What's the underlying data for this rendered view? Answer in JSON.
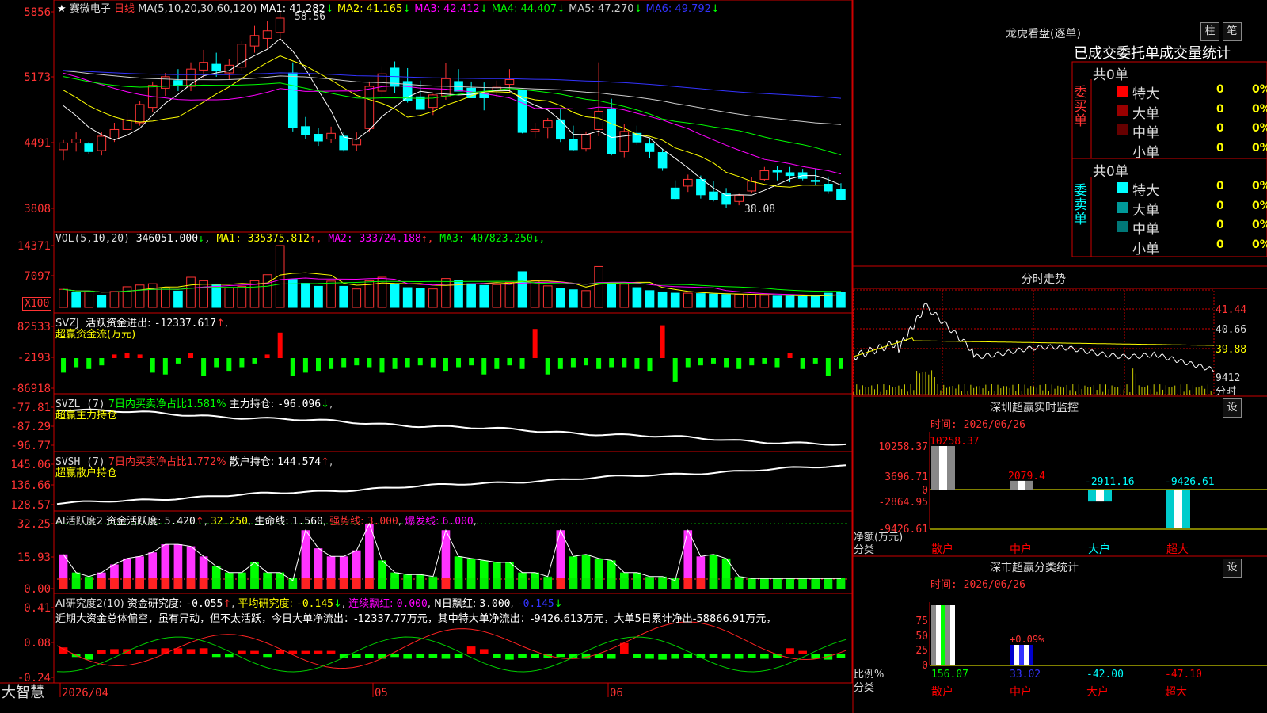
{
  "app_logo": "大智慧",
  "main_panel": {
    "stock_name": "赛微电子",
    "period": "日线",
    "ma_label": "MA(5,10,20,30,60,120)",
    "ma": [
      {
        "name": "MA1",
        "value": "41.282",
        "color": "#ffffff"
      },
      {
        "name": "MA2",
        "value": "41.165",
        "color": "#ffff00"
      },
      {
        "name": "MA3",
        "value": "42.412",
        "color": "#ff00ff"
      },
      {
        "name": "MA4",
        "value": "44.407",
        "color": "#00ff00"
      },
      {
        "name": "MA5",
        "value": "47.270",
        "color": "#cccccc"
      },
      {
        "name": "MA6",
        "value": "49.792",
        "color": "#3333ff"
      }
    ],
    "y_ticks": [
      "5856",
      "5173",
      "4491",
      "3808"
    ],
    "high_label": "58.56",
    "low_label": "38.08"
  },
  "vol_panel": {
    "label": "VOL(5,10,20)",
    "value": "346051.000",
    "ma": [
      {
        "name": "MA1",
        "value": "335375.812",
        "color": "#ffff00"
      },
      {
        "name": "MA2",
        "value": "333724.188",
        "color": "#ff00ff"
      },
      {
        "name": "MA3",
        "value": "407823.250",
        "color": "#00ff00"
      }
    ],
    "y_ticks": [
      "14371",
      "7097"
    ],
    "unit": "X100"
  },
  "svzj_panel": {
    "label": "SVZJ",
    "field": "活跃资金进出:",
    "value": "-12337.617",
    "subtitle": "超赢资金流(万元)",
    "y_ticks": [
      "82533",
      "-2193",
      "-86918"
    ]
  },
  "svzl_panel": {
    "label": "SVZL (7)",
    "ratio": "7日内买卖净占比1.581%",
    "field": "主力持仓:",
    "value": "-96.096",
    "subtitle": "超赢主力持仓",
    "y_ticks": [
      "-77.81",
      "-87.29",
      "-96.77"
    ]
  },
  "svsh_panel": {
    "label": "SVSH (7)",
    "ratio": "7日内买卖净占比1.772%",
    "field": "散户持仓:",
    "value": "144.574",
    "subtitle": "超赢散户持仓",
    "y_ticks": [
      "145.06",
      "136.66",
      "128.57"
    ]
  },
  "ai_active_panel": {
    "label": "AI活跃度2",
    "field": "资金活跃度:",
    "value": "5.420",
    "v2": "32.250",
    "life_label": "生命线:",
    "life": "1.560",
    "strong_label": "强势线:",
    "strong": "3.000",
    "burst_label": "爆发线:",
    "burst": "6.000",
    "y_ticks": [
      "32.25",
      "15.93",
      "0.00"
    ]
  },
  "ai_research_panel": {
    "label": "AI研究度2(10)",
    "field": "资金研究度:",
    "value": "-0.055",
    "avg_label": "平均研究度:",
    "avg": "-0.145",
    "red_label": "连续飘红:",
    "red": "0.000",
    "nred_label": "N日飘红:",
    "nred": "3.000",
    "last": "-0.145",
    "comment": "近期大资金总体偏空，虽有异动，但不太活跃，今日大单净流出：-12337.77万元，其中特大单净流出：-9426.613万元，大单5日累计净出-58866.91万元，",
    "y_ticks": [
      "0.41",
      "0.08",
      "-0.24"
    ]
  },
  "x_axis": {
    "labels": [
      "2026/04",
      "05",
      "06"
    ]
  },
  "dragon_tiger": {
    "title": "龙虎看盘(逐单)",
    "btn_bar": "柱",
    "btn_pen": "笔",
    "header": "已成交委托单成交量统计",
    "buy": {
      "side_label": "委买单",
      "total": "共0单",
      "rows": [
        {
          "name": "特大",
          "value": "0",
          "pct": "0%",
          "color": "#ff0000"
        },
        {
          "name": "大单",
          "value": "0",
          "pct": "0%",
          "color": "#990000"
        },
        {
          "name": "中单",
          "value": "0",
          "pct": "0%",
          "color": "#660000"
        },
        {
          "name": "小单",
          "value": "0",
          "pct": "0%",
          "color": "#000000"
        }
      ]
    },
    "sell": {
      "side_label": "委卖单",
      "total": "共0单",
      "rows": [
        {
          "name": "特大",
          "value": "0",
          "pct": "0%",
          "color": "#00ffff"
        },
        {
          "name": "大单",
          "value": "0",
          "pct": "0%",
          "color": "#009999"
        },
        {
          "name": "中单",
          "value": "0",
          "pct": "0%",
          "color": "#007777"
        },
        {
          "name": "小单",
          "value": "0",
          "pct": "0%",
          "color": "#000000"
        }
      ]
    }
  },
  "intraday": {
    "title": "分时走势",
    "y_ticks": [
      "41.44",
      "40.66",
      "39.88"
    ],
    "vol_tick": "9412",
    "unit": "分时"
  },
  "realtime_monitor": {
    "title": "深圳超赢实时监控",
    "btn": "设",
    "time_label": "时间: 2026/06/26",
    "y_ticks": [
      "10258.37",
      "3696.71",
      "0",
      "-2864.95",
      "-9426.61"
    ],
    "y_label": "净额(万元)",
    "x_label": "分类",
    "categories": [
      "散户",
      "中户",
      "大户",
      "超大"
    ],
    "values": [
      "10258.37",
      "2079.4",
      "-2911.16",
      "-9426.61"
    ],
    "category_colors": [
      "#ff0000",
      "#ff0000",
      "#00ffff",
      "#ff0000"
    ],
    "value_colors": [
      "#ff0000",
      "#ff0000",
      "#00ffff",
      "#00ffff"
    ]
  },
  "category_stats": {
    "title": "深市超赢分类统计",
    "btn": "设",
    "time_label": "时间: 2026/06/26",
    "y_ticks": [
      "75",
      "50",
      "25",
      "0"
    ],
    "y_label": "比例%",
    "x_label": "分类",
    "bar_label": "+0.09%",
    "categories": [
      "散户",
      "中户",
      "大户",
      "超大"
    ],
    "values": [
      "156.07",
      "33.02",
      "-42.00",
      "-47.10"
    ],
    "value_colors": [
      "#00ff00",
      "#3333ff",
      "#00ffff",
      "#ff0000"
    ]
  },
  "chart_data": [
    {
      "type": "candlestick",
      "title": "赛微电子 日线",
      "ylim": [
        38.08,
        58.56
      ],
      "ohlc": [
        [
          44.2,
          45.2,
          43.1,
          44.9
        ],
        [
          44.9,
          46.0,
          44.0,
          45.3
        ],
        [
          44.8,
          45.0,
          43.7,
          44.0
        ],
        [
          44.1,
          46.0,
          43.6,
          45.6
        ],
        [
          45.3,
          47.0,
          45.0,
          46.3
        ],
        [
          46.3,
          48.2,
          45.6,
          47.3
        ],
        [
          47.0,
          49.3,
          46.7,
          48.9
        ],
        [
          48.6,
          51.3,
          48.1,
          50.9
        ],
        [
          50.6,
          52.2,
          49.8,
          51.8
        ],
        [
          51.4,
          52.6,
          50.3,
          50.9
        ],
        [
          50.8,
          53.3,
          50.3,
          52.6
        ],
        [
          52.5,
          54.6,
          51.6,
          53.3
        ],
        [
          53.1,
          54.3,
          51.8,
          52.4
        ],
        [
          52.2,
          53.6,
          51.5,
          53.0
        ],
        [
          52.8,
          55.5,
          52.4,
          55.2
        ],
        [
          55.0,
          57.1,
          54.3,
          56.1
        ],
        [
          55.8,
          57.6,
          54.7,
          56.6
        ],
        [
          56.4,
          58.56,
          55.6,
          57.9
        ],
        [
          52.2,
          53.3,
          46.1,
          46.5
        ],
        [
          46.6,
          47.6,
          45.3,
          45.8
        ],
        [
          45.8,
          46.5,
          44.6,
          45.1
        ],
        [
          45.3,
          46.6,
          44.9,
          45.9
        ],
        [
          45.6,
          46.0,
          44.0,
          44.2
        ],
        [
          44.7,
          46.0,
          44.1,
          45.3
        ],
        [
          46.4,
          51.3,
          46.0,
          50.8
        ],
        [
          50.3,
          52.9,
          49.5,
          52.1
        ],
        [
          52.7,
          53.4,
          50.1,
          50.8
        ],
        [
          51.3,
          52.7,
          49.1,
          49.3
        ],
        [
          49.7,
          51.4,
          48.8,
          48.4
        ],
        [
          48.6,
          50.0,
          47.8,
          49.9
        ],
        [
          49.8,
          53.2,
          49.4,
          51.6
        ],
        [
          51.3,
          52.6,
          50.7,
          50.3
        ],
        [
          50.6,
          51.3,
          49.6,
          49.6
        ],
        [
          50.1,
          51.2,
          48.3,
          49.6
        ],
        [
          50.4,
          51.4,
          49.6,
          50.7
        ],
        [
          51.0,
          52.6,
          50.2,
          51.5
        ],
        [
          50.4,
          48.6,
          45.9,
          46.0
        ],
        [
          46.1,
          47.0,
          45.4,
          46.3
        ],
        [
          46.5,
          47.5,
          45.4,
          47.2
        ],
        [
          47.3,
          48.4,
          45.0,
          45.3
        ],
        [
          45.3,
          46.7,
          44.1,
          44.2
        ],
        [
          44.3,
          46.1,
          44.0,
          45.8
        ],
        [
          46.3,
          53.3,
          45.6,
          48.2
        ],
        [
          48.4,
          49.5,
          43.6,
          43.8
        ],
        [
          44.0,
          46.9,
          43.4,
          46.1
        ],
        [
          45.9,
          46.7,
          44.7,
          45.0
        ],
        [
          44.8,
          45.3,
          43.3,
          44.0
        ],
        [
          43.9,
          44.3,
          42.0,
          42.3
        ],
        [
          40.2,
          41.0,
          39.0,
          39.1
        ],
        [
          40.4,
          41.6,
          39.8,
          41.1
        ],
        [
          41.1,
          41.5,
          39.1,
          39.5
        ],
        [
          39.8,
          40.9,
          38.8,
          39.0
        ],
        [
          39.6,
          40.2,
          38.08,
          38.5
        ],
        [
          38.8,
          39.6,
          38.4,
          39.4
        ],
        [
          39.9,
          41.3,
          39.7,
          40.9
        ],
        [
          41.1,
          42.4,
          40.9,
          42.0
        ],
        [
          42.0,
          42.5,
          41.0,
          41.9
        ],
        [
          41.8,
          42.4,
          40.8,
          41.5
        ],
        [
          41.8,
          42.2,
          41.0,
          41.2
        ],
        [
          41.0,
          42.2,
          40.5,
          40.9
        ],
        [
          40.6,
          41.4,
          39.6,
          39.9
        ],
        [
          40.1,
          40.7,
          38.9,
          39.0
        ]
      ]
    },
    {
      "type": "bar",
      "title": "VOL(5,10,20)",
      "ylim": [
        0,
        14371
      ],
      "values": [
        4200,
        3500,
        3800,
        2800,
        3700,
        4800,
        5200,
        5500,
        4600,
        3800,
        7000,
        6200,
        5200,
        4600,
        4900,
        6200,
        7600,
        14371,
        6500,
        5600,
        4900,
        6100,
        4900,
        4300,
        6200,
        7000,
        5400,
        4600,
        4500,
        4300,
        6700,
        6200,
        5500,
        5100,
        5300,
        5800,
        8300,
        6200,
        5000,
        4500,
        4100,
        3900,
        9500,
        5700,
        5400,
        4600,
        3900,
        3600,
        3300,
        3300,
        3200,
        3100,
        3000,
        3000,
        2900,
        2800,
        2600,
        2600,
        2500,
        2700,
        3300,
        3460
      ],
      "up": [
        1,
        0,
        1,
        0,
        1,
        1,
        1,
        1,
        1,
        0,
        1,
        1,
        0,
        1,
        1,
        1,
        1,
        1,
        0,
        0,
        0,
        1,
        0,
        1,
        1,
        1,
        0,
        0,
        0,
        1,
        1,
        0,
        0,
        0,
        1,
        1,
        0,
        1,
        1,
        0,
        0,
        1,
        1,
        0,
        1,
        0,
        0,
        0,
        0,
        1,
        0,
        0,
        0,
        1,
        1,
        1,
        0,
        0,
        0,
        0,
        0,
        0
      ]
    },
    {
      "type": "bar",
      "title": "SVZJ",
      "ylim": [
        -86918,
        82533
      ],
      "values": [
        -8,
        -5,
        -6,
        -4,
        2,
        3,
        2,
        -8,
        -9,
        -3,
        3,
        -10,
        -5,
        -7,
        -5,
        -3,
        2,
        14,
        -10,
        -8,
        -7,
        -6,
        -5,
        -4,
        -5,
        -8,
        -6,
        -5,
        -4,
        -5,
        -7,
        -5,
        -4,
        -9,
        -6,
        -4,
        -6,
        16,
        -9,
        -6,
        -5,
        -4,
        -6,
        -5,
        -5,
        -6,
        -7,
        18,
        -13,
        -5,
        -4,
        -3,
        -5,
        -6,
        -4,
        -3,
        -5,
        3,
        -6,
        -3,
        -10,
        -6
      ]
    },
    {
      "type": "bar",
      "title": "AI活跃度2",
      "ylim": [
        0,
        32.25
      ],
      "values": [
        17,
        8,
        6,
        8,
        12,
        15,
        16,
        18,
        22,
        22,
        21,
        16,
        11,
        8,
        8,
        13,
        8,
        8,
        4,
        29,
        20,
        16,
        16,
        19,
        32.25,
        14,
        8,
        7,
        7,
        6,
        29,
        16,
        15,
        14,
        13,
        13,
        8,
        8,
        6,
        29,
        16,
        17,
        15,
        14,
        8,
        8,
        6,
        6,
        4,
        29,
        16,
        17,
        15,
        6,
        5,
        5,
        5,
        5,
        5,
        5,
        5,
        5
      ],
      "pink": [
        1,
        0,
        0,
        1,
        1,
        1,
        1,
        1,
        1,
        1,
        1,
        1,
        0,
        0,
        0,
        0,
        0,
        0,
        0,
        1,
        1,
        1,
        1,
        1,
        1,
        0,
        0,
        0,
        0,
        0,
        1,
        0,
        0,
        0,
        0,
        0,
        0,
        0,
        0,
        1,
        0,
        0,
        0,
        0,
        0,
        0,
        0,
        0,
        0,
        1,
        1,
        0,
        0,
        0,
        0,
        0,
        0,
        0,
        0,
        0,
        0,
        0
      ]
    }
  ]
}
